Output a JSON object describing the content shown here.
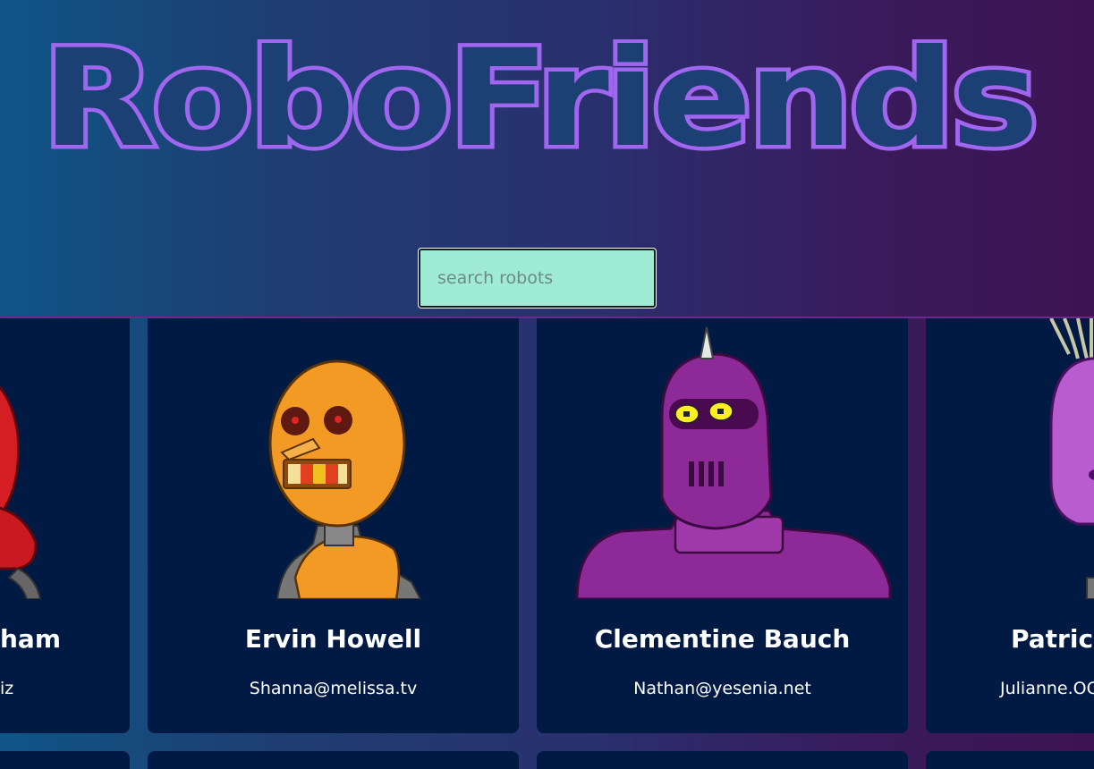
{
  "app": {
    "title": "RoboFriends"
  },
  "search": {
    "placeholder": "search robots",
    "value": ""
  },
  "colors": {
    "title_outline": "#a066f0",
    "search_bg": "#a0ebd4",
    "card_bg": "#001a43",
    "robot_orange": "#f39a25",
    "robot_purple": "#8e2a98",
    "robot_red": "#d51e24"
  },
  "robots": [
    {
      "name": "Leanne Graham",
      "email": "Sincere@april.biz",
      "visible_name": "ham",
      "visible_email": "iz"
    },
    {
      "name": "Ervin Howell",
      "email": "Shanna@melissa.tv"
    },
    {
      "name": "Clementine Bauch",
      "email": "Nathan@yesenia.net"
    },
    {
      "name": "Patricia",
      "email": "Julianne.OC",
      "visible_name": "Patricia",
      "visible_email": "Julianne.OC"
    }
  ]
}
